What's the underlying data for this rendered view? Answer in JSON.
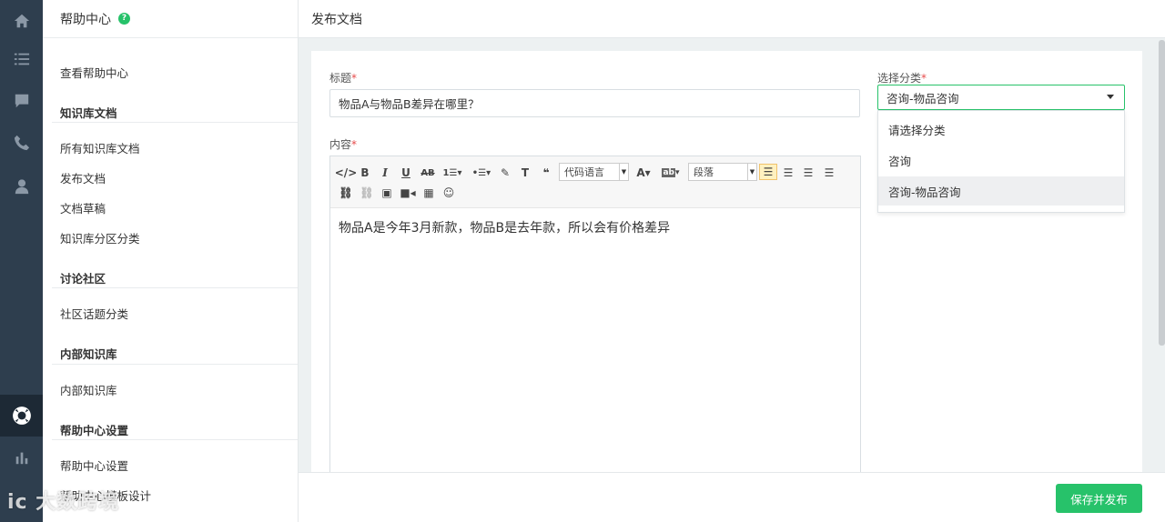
{
  "rail": {
    "items": [
      {
        "icon": "home-icon"
      },
      {
        "icon": "list-icon"
      },
      {
        "icon": "chat-icon"
      },
      {
        "icon": "phone-icon"
      },
      {
        "icon": "user-icon"
      },
      {
        "icon": "lifebuoy-icon"
      },
      {
        "icon": "bar-chart-icon"
      }
    ]
  },
  "sidebar": {
    "title": "帮助中心",
    "help_badge": "?",
    "view_help": "查看帮助中心",
    "sections": [
      {
        "title": "知识库文档",
        "items": [
          "所有知识库文档",
          "发布文档",
          "文档草稿",
          "知识库分区分类"
        ]
      },
      {
        "title": "讨论社区",
        "items": [
          "社区话题分类"
        ]
      },
      {
        "title": "内部知识库",
        "items": [
          "内部知识库"
        ]
      },
      {
        "title": "帮助中心设置",
        "items": [
          "帮助中心设置",
          "帮助中心模板设计"
        ]
      }
    ]
  },
  "main": {
    "page_title": "发布文档",
    "title_label": "标题",
    "title_value": "物品A与物品B差异在哪里？",
    "content_label": "内容",
    "required_mark": "*",
    "editor": {
      "code_lang_select": "代码语言",
      "paragraph_select": "段落",
      "content": "物品A是今年3月新款，物品B是去年款，所以会有价格差异"
    },
    "category": {
      "label": "选择分类",
      "selected": "咨询-物品咨询",
      "options": [
        "请选择分类",
        "咨询",
        "咨询-物品咨询"
      ]
    },
    "save_button": "保存并发布"
  },
  "watermark": "ic 大数跨境",
  "colors": {
    "accent": "#27c26a",
    "rail_bg": "#2e3e4e",
    "required": "#e64c4c"
  }
}
